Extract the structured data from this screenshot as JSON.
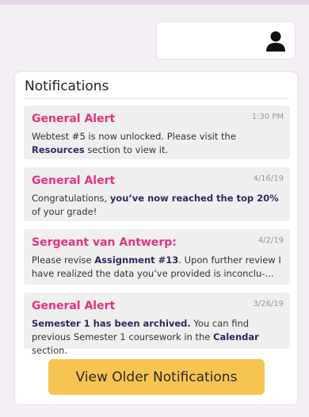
{
  "header": {
    "profile_icon": "user-icon"
  },
  "notifications": {
    "title": "Notifications",
    "items": [
      {
        "sender": "General Alert",
        "time": "1:30 PM",
        "body": [
          {
            "t": "Webtest #5 is now unlocked. Please visit the "
          },
          {
            "t": "Resources",
            "b": true
          },
          {
            "t": " section to view it."
          }
        ]
      },
      {
        "sender": "General Alert",
        "time": "4/16/19",
        "body": [
          {
            "t": "Congratulations, "
          },
          {
            "t": "you’ve now reached the top 20%",
            "b": true
          },
          {
            "t": " of your grade!"
          }
        ]
      },
      {
        "sender": "Sergeant van Antwerp:",
        "time": "4/2/19",
        "body": [
          {
            "t": "Please revise "
          },
          {
            "t": "Assignment #13",
            "b": true
          },
          {
            "t": ". Upon further review I have realized the data you’ve provided is inconclu-..."
          }
        ]
      },
      {
        "sender": "General Alert",
        "time": "3/26/19",
        "body": [
          {
            "t": "Semester 1 has been archived.",
            "b": true
          },
          {
            "t": " You can find previous Semester 1 coursework in the "
          },
          {
            "t": "Calendar",
            "b": true
          },
          {
            "t": " section."
          }
        ]
      }
    ],
    "older_button_label": "View Older Notifications"
  },
  "colors": {
    "accent_pink": "#e8327c",
    "button_yellow": "#f6c451",
    "bold_text": "#2d2b5e"
  }
}
